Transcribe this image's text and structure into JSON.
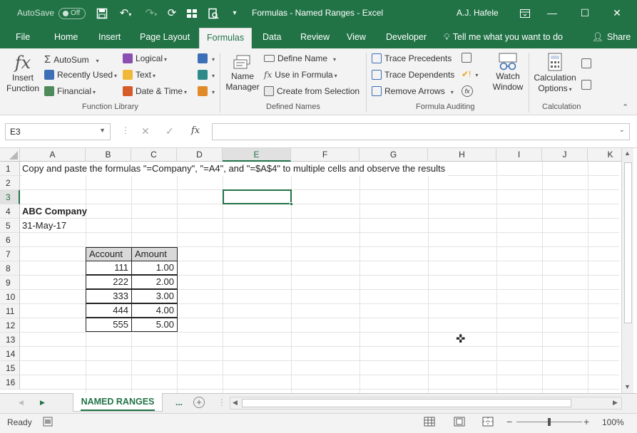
{
  "titlebar": {
    "autosave_label": "AutoSave",
    "autosave_state": "Off",
    "document_title": "Formulas - Named Ranges - Excel",
    "user_name": "A.J. Hafele"
  },
  "tabs": [
    {
      "label": "File"
    },
    {
      "label": "Home"
    },
    {
      "label": "Insert"
    },
    {
      "label": "Page Layout"
    },
    {
      "label": "Formulas"
    },
    {
      "label": "Data"
    },
    {
      "label": "Review"
    },
    {
      "label": "View"
    },
    {
      "label": "Developer"
    }
  ],
  "tell_me": "Tell me what you want to do",
  "share": "Share",
  "ribbon": {
    "insert_function": {
      "line1": "Insert",
      "line2": "Function"
    },
    "library": {
      "autosum": "AutoSum",
      "recently_used": "Recently Used",
      "financial": "Financial",
      "logical": "Logical",
      "text": "Text",
      "date_time": "Date & Time",
      "group_label": "Function Library"
    },
    "names": {
      "name_manager": {
        "line1": "Name",
        "line2": "Manager"
      },
      "define_name": "Define Name",
      "use_in_formula": "Use in Formula",
      "create_from_selection": "Create from Selection",
      "group_label": "Defined Names"
    },
    "auditing": {
      "trace_precedents": "Trace Precedents",
      "trace_dependents": "Trace Dependents",
      "remove_arrows": "Remove Arrows",
      "watch_window": {
        "line1": "Watch",
        "line2": "Window"
      },
      "group_label": "Formula Auditing"
    },
    "calculation": {
      "calc_options": {
        "line1": "Calculation",
        "line2": "Options"
      },
      "group_label": "Calculation"
    }
  },
  "formula_bar": {
    "name_box": "E3",
    "fx": "fx",
    "formula": ""
  },
  "columns": [
    "A",
    "B",
    "C",
    "D",
    "E",
    "F",
    "G",
    "H",
    "I",
    "J",
    "K"
  ],
  "rows": [
    "1",
    "2",
    "3",
    "4",
    "5",
    "6",
    "7",
    "8",
    "9",
    "10",
    "11",
    "12",
    "13",
    "14",
    "15",
    "16"
  ],
  "cells": {
    "a1": "Copy and paste the formulas \"=Company\", \"=A4\", and \"=$A$4\" to multiple cells and observe the results",
    "a4": "ABC Company",
    "a5": "31-May-17"
  },
  "table": {
    "headers": [
      "Account",
      "Amount"
    ],
    "rows": [
      [
        "111",
        "1.00"
      ],
      [
        "222",
        "2.00"
      ],
      [
        "333",
        "3.00"
      ],
      [
        "444",
        "4.00"
      ],
      [
        "555",
        "5.00"
      ]
    ]
  },
  "sheet_tabs": {
    "active": "NAMED RANGES",
    "more": "..."
  },
  "status": {
    "ready": "Ready",
    "zoom": "100%"
  },
  "colors": {
    "excel_green": "#217346",
    "table_header_fill": "#d9d9d9"
  }
}
